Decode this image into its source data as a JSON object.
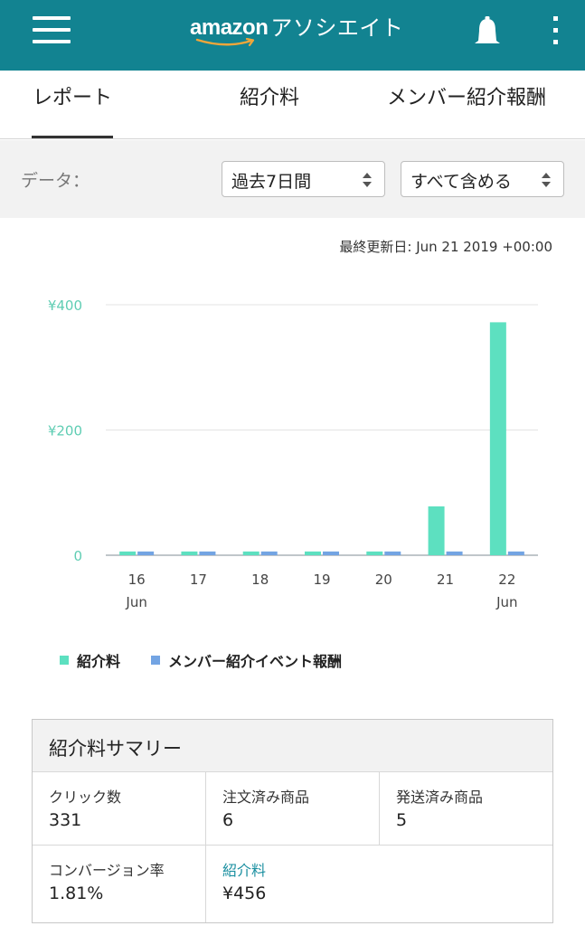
{
  "header": {
    "brand_main": "amazon",
    "brand_sub": "アソシエイト",
    "menu_icon": "hamburger-menu-icon",
    "notification_icon": "bell-icon",
    "more_icon": "more-vertical-icon",
    "color": "#128391"
  },
  "tabs": [
    {
      "label": "レポート",
      "active": true
    },
    {
      "label": "紹介料",
      "active": false
    },
    {
      "label": "メンバー紹介報酬",
      "active": false
    }
  ],
  "filters": {
    "label": "データ：",
    "period": "過去7日間",
    "include": "すべて含める"
  },
  "last_updated": "最終更新日: Jun 21 2019 +00:00",
  "chart_data": {
    "type": "bar",
    "categories": [
      "16",
      "17",
      "18",
      "19",
      "20",
      "21",
      "22"
    ],
    "category_month_labels": [
      "Jun",
      "",
      "",
      "",
      "",
      "",
      "Jun"
    ],
    "series": [
      {
        "name": "紹介料",
        "color": "#5de0c0",
        "values": [
          6,
          6,
          6,
          6,
          6,
          78,
          372
        ]
      },
      {
        "name": "メンバー紹介イベント報酬",
        "color": "#73a4e3",
        "values": [
          6,
          6,
          6,
          6,
          6,
          6,
          6
        ]
      }
    ],
    "yticks": [
      {
        "value": 0,
        "label": "0"
      },
      {
        "value": 200,
        "label": "¥200"
      },
      {
        "value": 400,
        "label": "¥400"
      }
    ],
    "ylim": [
      0,
      400
    ],
    "grid": true,
    "legend_position": "bottom-left",
    "title": "",
    "xlabel": "",
    "ylabel": ""
  },
  "summary": {
    "title": "紹介料サマリー",
    "cells": [
      {
        "label": "クリック数",
        "value": "331"
      },
      {
        "label": "注文済み商品",
        "value": "6"
      },
      {
        "label": "発送済み商品",
        "value": "5"
      },
      {
        "label": "コンバージョン率",
        "value": "1.81%"
      },
      {
        "label": "紹介料",
        "value": "¥456"
      }
    ]
  }
}
